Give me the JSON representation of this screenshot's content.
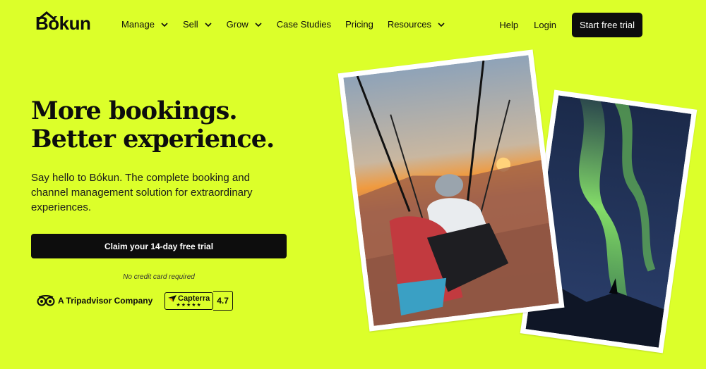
{
  "brand": {
    "logo_text": "Bókun"
  },
  "nav": {
    "items": [
      {
        "label": "Manage",
        "has_dropdown": true
      },
      {
        "label": "Sell",
        "has_dropdown": true
      },
      {
        "label": "Grow",
        "has_dropdown": true
      },
      {
        "label": "Case Studies",
        "has_dropdown": false
      },
      {
        "label": "Pricing",
        "has_dropdown": false
      },
      {
        "label": "Resources",
        "has_dropdown": true
      }
    ],
    "help": "Help",
    "login": "Login",
    "cta": "Start free trial"
  },
  "hero": {
    "title_line1": "More bookings.",
    "title_line2": "Better experience.",
    "subtitle": "Say hello to Bókun. The complete booking and channel management solution for extraordinary experiences.",
    "cta": "Claim your 14-day free trial",
    "note": "No credit card required"
  },
  "badges": {
    "tripadvisor": "A Tripadvisor Company",
    "capterra_name": "Capterra",
    "capterra_stars": "★★★★★",
    "capterra_score": "4.7"
  },
  "colors": {
    "background": "#DCFF2A",
    "primary_dark": "#0D0D0D"
  }
}
